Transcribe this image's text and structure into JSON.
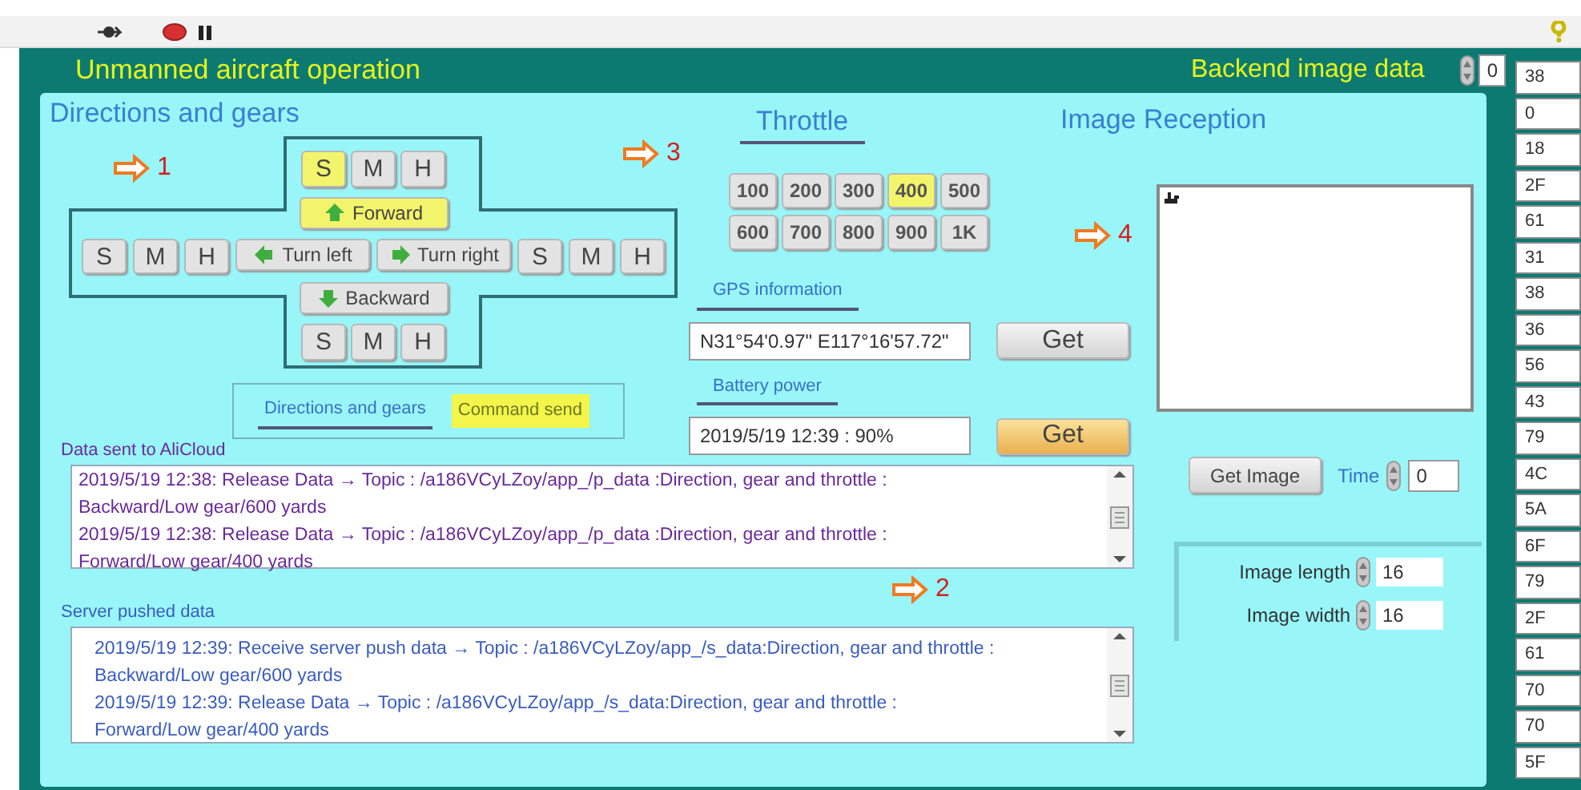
{
  "title": "Unmanned aircraft operation",
  "backend": {
    "label": "Backend image data",
    "value": "0"
  },
  "directions": {
    "title": "Directions and gears",
    "annotation": "1",
    "top_gears": [
      {
        "label": "S",
        "selected": true
      },
      {
        "label": "M",
        "selected": false
      },
      {
        "label": "H",
        "selected": false
      }
    ],
    "forward": {
      "label": "Forward",
      "selected": true
    },
    "left_gears": [
      {
        "label": "S",
        "selected": false
      },
      {
        "label": "M",
        "selected": false
      },
      {
        "label": "H",
        "selected": false
      }
    ],
    "turn_left": {
      "label": "Turn left",
      "selected": false
    },
    "turn_right": {
      "label": "Turn right",
      "selected": false
    },
    "right_gears": [
      {
        "label": "S",
        "selected": false
      },
      {
        "label": "M",
        "selected": false
      },
      {
        "label": "H",
        "selected": false
      }
    ],
    "backward": {
      "label": "Backward",
      "selected": false
    },
    "bottom_gears": [
      {
        "label": "S",
        "selected": false
      },
      {
        "label": "M",
        "selected": false
      },
      {
        "label": "H",
        "selected": false
      }
    ]
  },
  "tabs": [
    {
      "label": "Directions and gears",
      "selected": false
    },
    {
      "label": "Command send",
      "selected": true
    }
  ],
  "throttle": {
    "title": "Throttle",
    "annotation": "3",
    "buttons": [
      {
        "label": "100",
        "selected": false
      },
      {
        "label": "200",
        "selected": false
      },
      {
        "label": "300",
        "selected": false
      },
      {
        "label": "400",
        "selected": true
      },
      {
        "label": "500",
        "selected": false
      },
      {
        "label": "600",
        "selected": false
      },
      {
        "label": "700",
        "selected": false
      },
      {
        "label": "800",
        "selected": false
      },
      {
        "label": "900",
        "selected": false
      },
      {
        "label": "1K",
        "selected": false
      }
    ]
  },
  "gps": {
    "label": "GPS information",
    "value": "N31°54'0.97\"  E117°16'57.72\"",
    "button": {
      "label": "Get",
      "highlighted": false
    }
  },
  "battery": {
    "label": "Battery power",
    "value": "2019/5/19 12:39 : 90%",
    "button": {
      "label": "Get",
      "highlighted": true
    }
  },
  "image_reception": {
    "title": "Image Reception",
    "annotation": "4"
  },
  "get_image": {
    "label": "Get Image"
  },
  "time": {
    "label": "Time",
    "value": "0"
  },
  "image_length": {
    "label": "Image length",
    "value": "16"
  },
  "image_width": {
    "label": "Image width",
    "value": "16"
  },
  "logs": [
    {
      "label": "Data sent to AliCloud",
      "annotation": "2",
      "entries": [
        "2019/5/19 12:38:  Release Data → Topic : /a186VCyLZoy/app_/p_data :Direction, gear and throttle : Backward/Low gear/600 yards",
        "2019/5/19 12:38:  Release Data → Topic : /a186VCyLZoy/app_/p_data :Direction, gear and throttle : Forward/Low gear/400 yards"
      ]
    },
    {
      "label": "Server pushed data",
      "entries": [
        "2019/5/19 12:39:  Receive server push data → Topic : /a186VCyLZoy/app_/s_data:Direction, gear and throttle :  Backward/Low gear/600 yards",
        "2019/5/19 12:39:  Release Data → Topic : /a186VCyLZoy/app_/s_data:Direction, gear and throttle : Forward/Low gear/400 yards"
      ]
    }
  ],
  "hex_values": [
    "38",
    "0",
    "18",
    "2F",
    "61",
    "31",
    "38",
    "36",
    "56",
    "43",
    "79",
    "4C",
    "5A",
    "6F",
    "79",
    "2F",
    "61",
    "70",
    "70",
    "5F"
  ]
}
